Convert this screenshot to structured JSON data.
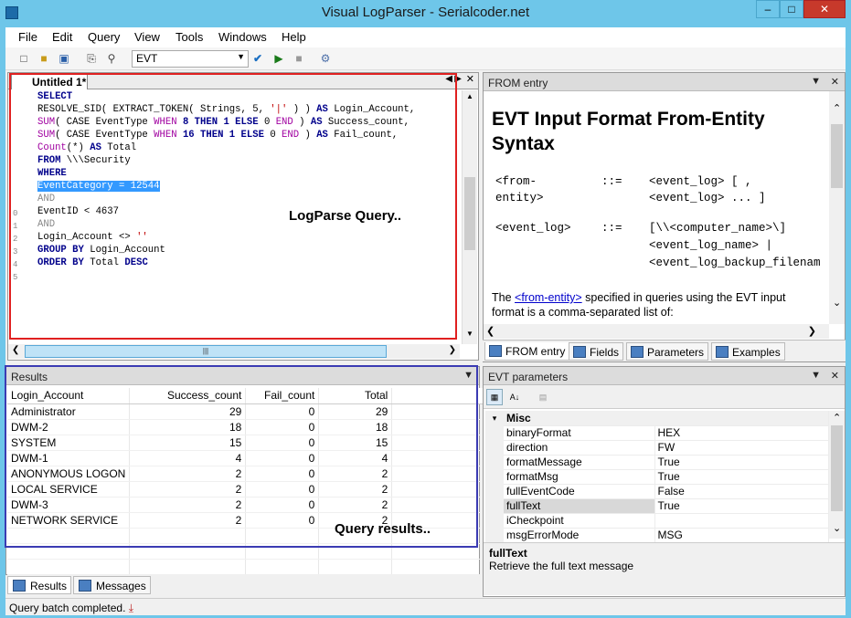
{
  "window": {
    "title": "Visual LogParser - Serialcoder.net"
  },
  "menu": [
    "File",
    "Edit",
    "Query",
    "View",
    "Tools",
    "Windows",
    "Help"
  ],
  "toolbar": {
    "input_format": "EVT"
  },
  "editor": {
    "tab_label": "Untitled 1*",
    "annotation": "LogParse Query..",
    "line_numbers": [
      "0",
      "1",
      "2",
      "3",
      "4",
      "5"
    ]
  },
  "from_entry": {
    "header": "FROM entry",
    "heading": "EVT Input Format From-Entity Syntax",
    "grammar": {
      "from_tok1": "<from-",
      "from_tok2": "entity>",
      "def1": "::=",
      "rhs1a": "<event_log> [ ,",
      "rhs1b": "<event_log> ... ]",
      "ev_tok": "<event_log>",
      "def2": "::=",
      "rhs2a": "[\\\\<computer_name>\\]",
      "rhs2b": "<event_log_name> |",
      "rhs2c": "<event_log_backup_filenam"
    },
    "para_pre": "The ",
    "para_link": "<from-entity>",
    "para_post": " specified in queries using the EVT input",
    "para_line2": "format is a comma-separated list of:",
    "tabs": [
      "FROM entry",
      "Fields",
      "Parameters",
      "Examples"
    ]
  },
  "results": {
    "header": "Results",
    "annotation": "Query results..",
    "columns": [
      "Login_Account",
      "Success_count",
      "Fail_count",
      "Total"
    ],
    "rows": [
      [
        "Administrator",
        "29",
        "0",
        "29"
      ],
      [
        "DWM-2",
        "18",
        "0",
        "18"
      ],
      [
        "SYSTEM",
        "15",
        "0",
        "15"
      ],
      [
        "DWM-1",
        "4",
        "0",
        "4"
      ],
      [
        "ANONYMOUS LOGON",
        "2",
        "0",
        "2"
      ],
      [
        "LOCAL SERVICE",
        "2",
        "0",
        "2"
      ],
      [
        "DWM-3",
        "2",
        "0",
        "2"
      ],
      [
        "NETWORK SERVICE",
        "2",
        "0",
        "2"
      ]
    ],
    "tabs": [
      "Results",
      "Messages"
    ]
  },
  "params": {
    "header": "EVT parameters",
    "category": "Misc",
    "rows": [
      [
        "binaryFormat",
        "HEX"
      ],
      [
        "direction",
        "FW"
      ],
      [
        "formatMessage",
        "True"
      ],
      [
        "formatMsg",
        "True"
      ],
      [
        "fullEventCode",
        "False"
      ],
      [
        "fullText",
        "True"
      ],
      [
        "iCheckpoint",
        ""
      ],
      [
        "msgErrorMode",
        "MSG"
      ]
    ],
    "selected": "fullText",
    "desc_title": "fullText",
    "desc_text": "Retrieve the full text message"
  },
  "status": {
    "text": "Query batch completed."
  }
}
